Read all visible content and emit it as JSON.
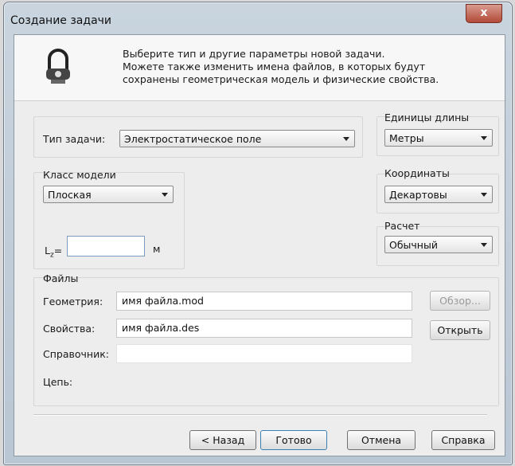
{
  "window": {
    "title": "Создание задачи",
    "close_label": "x"
  },
  "header": {
    "lines": [
      "Выберите тип и другие параметры новой задачи.",
      "Можете также изменить имена файлов, в которых будут",
      "сохранены геометрическая модель и физические свойства."
    ]
  },
  "task_type": {
    "label": "Тип задачи:",
    "value": "Электростатическое поле"
  },
  "length_units": {
    "label": "Единицы длины",
    "value": "Метры"
  },
  "model_class": {
    "label": "Класс модели",
    "value": "Плоская"
  },
  "coordinates": {
    "label": "Координаты",
    "value": "Декартовы"
  },
  "calculation": {
    "label": "Расчет",
    "value": "Обычный"
  },
  "lz": {
    "label": "L",
    "subscript": "z",
    "equals": "=",
    "value": "",
    "unit": "м"
  },
  "files": {
    "label": "Файлы",
    "geometry": {
      "label": "Геометрия:",
      "value": "имя файла.mod"
    },
    "properties": {
      "label": "Свойства:",
      "value": "имя файла.des"
    },
    "reference": {
      "label": "Справочник:",
      "value": ""
    },
    "circuit": {
      "label": "Цепь:"
    },
    "browse_label": "Обзор...",
    "open_label": "Открыть"
  },
  "buttons": {
    "back": "< Назад",
    "finish": "Готово",
    "cancel": "Отмена",
    "help": "Справка"
  }
}
